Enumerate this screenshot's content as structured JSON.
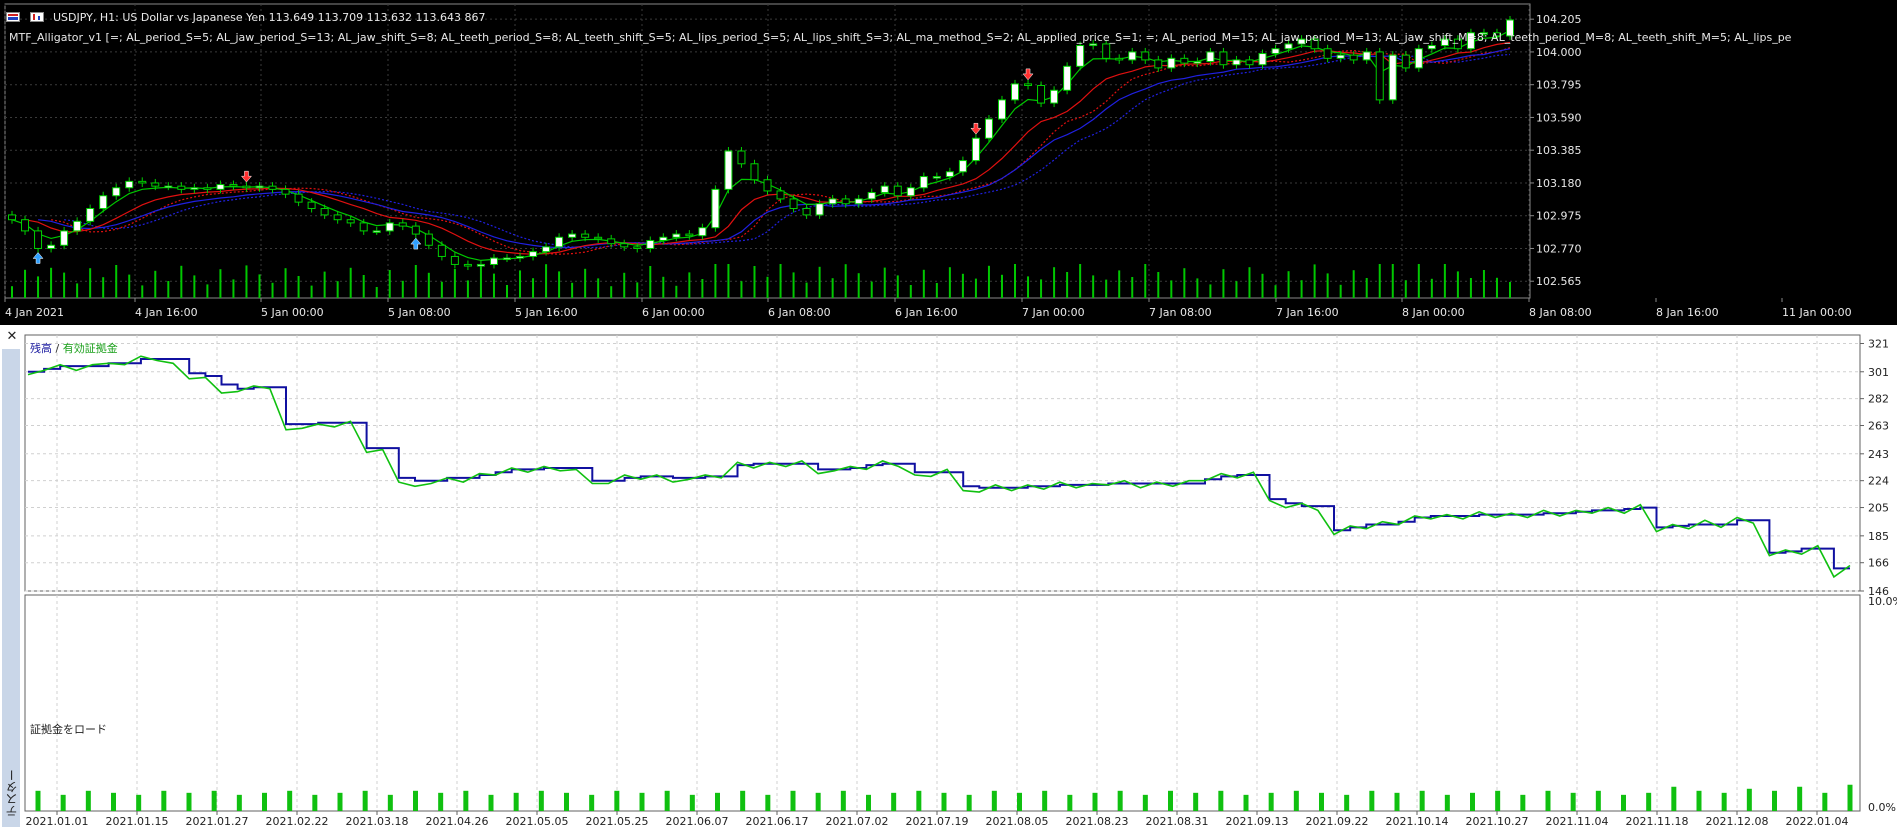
{
  "price_chart": {
    "symbol_text": "USDJPY, H1:  US Dollar vs Japanese Yen  113.649 113.709 113.632 113.643  867",
    "indicator_label": "MTF_Alligator_v1 [=; AL_period_S=5; AL_jaw_period_S=13; AL_jaw_shift_S=8; AL_teeth_period_S=8; AL_teeth_shift_S=5; AL_lips_period_S=5; AL_lips_shift_S=3; AL_ma_method_S=2; AL_applied_price_S=1; =; AL_period_M=15; AL_jaw_period_M=13; AL_jaw_shift_M=8; AL_teeth_period_M=8; AL_teeth_shift_M=5; AL_lips_pe",
    "price_axis": [
      "104.205",
      "104.000",
      "103.795",
      "103.590",
      "103.385",
      "103.180",
      "102.975",
      "102.770",
      "102.565"
    ],
    "time_axis": [
      "4 Jan 2021",
      "4 Jan 16:00",
      "5 Jan 00:00",
      "5 Jan 08:00",
      "5 Jan 16:00",
      "6 Jan 00:00",
      "6 Jan 08:00",
      "6 Jan 16:00",
      "7 Jan 00:00",
      "7 Jan 08:00",
      "7 Jan 16:00",
      "8 Jan 00:00",
      "8 Jan 08:00",
      "8 Jan 16:00",
      "11 Jan 00:00"
    ],
    "colors": {
      "background": "#000000",
      "grid": "#3a3a3a",
      "candle_up": "#ffffff",
      "candle_down": "#000000",
      "lips": "#00c800",
      "teeth": "#e01010",
      "jaw": "#2020e0",
      "volume": "#00c800",
      "sell_arrow": "#ff3030",
      "buy_arrow": "#30a0ff"
    },
    "y_range": [
      102.46,
      104.3
    ]
  },
  "tester": {
    "tab_label": "テスター",
    "legend_balance": "残高",
    "legend_sep": " / ",
    "legend_equity": "有効証拠金",
    "load_label": "証拠金をロード",
    "balance_axis": [
      "321",
      "301",
      "282",
      "263",
      "243",
      "224",
      "205",
      "185",
      "166",
      "146"
    ],
    "load_axis": [
      "10.0%",
      "0.0%"
    ],
    "date_axis": [
      "2021.01.01",
      "2021.01.15",
      "2021.01.27",
      "2021.02.22",
      "2021.03.18",
      "2021.04.26",
      "2021.05.05",
      "2021.05.25",
      "2021.06.07",
      "2021.06.17",
      "2021.07.02",
      "2021.07.19",
      "2021.08.05",
      "2021.08.23",
      "2021.08.31",
      "2021.09.13",
      "2021.09.22",
      "2021.10.14",
      "2021.10.27",
      "2021.11.04",
      "2021.11.18",
      "2021.12.08",
      "2022.01.04"
    ],
    "colors": {
      "balance": "#1010a0",
      "equity": "#10c010",
      "load": "#10c010",
      "grid": "#d0d0d0"
    },
    "y_range": [
      146,
      327
    ]
  },
  "chart_data": [
    {
      "type": "candlestick",
      "title": "USDJPY, H1:  US Dollar vs Japanese Yen  113.649 113.709 113.632 113.643  867",
      "y_axis_ticks": [
        104.205,
        104.0,
        103.795,
        103.59,
        103.385,
        103.18,
        102.975,
        102.77,
        102.565
      ],
      "x_axis_ticks": [
        "4 Jan 2021",
        "4 Jan 16:00",
        "5 Jan 00:00",
        "5 Jan 08:00",
        "5 Jan 16:00",
        "6 Jan 00:00",
        "6 Jan 08:00",
        "6 Jan 16:00",
        "7 Jan 00:00",
        "7 Jan 08:00",
        "7 Jan 16:00",
        "8 Jan 00:00",
        "8 Jan 08:00",
        "8 Jan 16:00",
        "11 Jan 00:00"
      ],
      "close": [
        102.95,
        102.88,
        102.77,
        102.79,
        102.88,
        102.94,
        103.02,
        103.1,
        103.15,
        103.19,
        103.18,
        103.16,
        103.16,
        103.14,
        103.15,
        103.14,
        103.17,
        103.16,
        103.15,
        103.16,
        103.14,
        103.11,
        103.06,
        103.02,
        102.98,
        102.95,
        102.93,
        102.88,
        102.88,
        102.93,
        102.91,
        102.86,
        102.79,
        102.72,
        102.67,
        102.66,
        102.67,
        102.71,
        102.71,
        102.72,
        102.75,
        102.78,
        102.84,
        102.86,
        102.84,
        102.83,
        102.8,
        102.78,
        102.77,
        102.82,
        102.84,
        102.86,
        102.85,
        102.9,
        103.14,
        103.38,
        103.3,
        103.2,
        103.13,
        103.08,
        103.02,
        102.98,
        103.05,
        103.08,
        103.05,
        103.08,
        103.12,
        103.16,
        103.1,
        103.15,
        103.22,
        103.22,
        103.25,
        103.32,
        103.46,
        103.58,
        103.7,
        103.8,
        103.79,
        103.68,
        103.76,
        103.91,
        104.04,
        104.05,
        103.96,
        103.95,
        104.0,
        103.95,
        103.9,
        103.96,
        103.93,
        103.94,
        104.0,
        103.92,
        103.95,
        103.92,
        103.99,
        104.02,
        104.05,
        104.08,
        104.02,
        103.96,
        103.98,
        103.95,
        104.0,
        103.7,
        103.98,
        103.9,
        104.02,
        104.04,
        104.08,
        104.02,
        104.12,
        104.12,
        104.1,
        104.2
      ],
      "series": [
        {
          "name": "lips",
          "color": "#00c800"
        },
        {
          "name": "teeth",
          "color": "#e01010"
        },
        {
          "name": "jaw",
          "color": "#2020e0"
        }
      ]
    },
    {
      "type": "line",
      "legend": [
        "残高",
        "有効証拠金"
      ],
      "y_axis_ticks": [
        321,
        301,
        282,
        263,
        243,
        224,
        205,
        185,
        166,
        146
      ],
      "x_axis_ticks": [
        "2021.01.01",
        "2021.01.15",
        "2021.01.27",
        "2021.02.22",
        "2021.03.18",
        "2021.04.26",
        "2021.05.05",
        "2021.05.25",
        "2021.06.07",
        "2021.06.17",
        "2021.07.02",
        "2021.07.19",
        "2021.08.05",
        "2021.08.23",
        "2021.08.31",
        "2021.09.13",
        "2021.09.22",
        "2021.10.14",
        "2021.10.27",
        "2021.11.04",
        "2021.11.18",
        "2021.12.08",
        "2022.01.04"
      ],
      "ylim": [
        146,
        327
      ],
      "balance": [
        301,
        303,
        305,
        305,
        305,
        307,
        307,
        310,
        310,
        310,
        300,
        298,
        292,
        289,
        290,
        290,
        264,
        264,
        265,
        265,
        265,
        247,
        247,
        226,
        224,
        224,
        226,
        226,
        228,
        230,
        232,
        232,
        233,
        233,
        233,
        224,
        224,
        226,
        227,
        227,
        226,
        226,
        227,
        227,
        235,
        236,
        236,
        236,
        236,
        232,
        232,
        233,
        235,
        236,
        236,
        230,
        230,
        230,
        220,
        219,
        219,
        219,
        220,
        220,
        221,
        221,
        221,
        222,
        222,
        222,
        222,
        222,
        222,
        225,
        227,
        228,
        228,
        211,
        208,
        206,
        206,
        189,
        191,
        193,
        193,
        195,
        198,
        199,
        199,
        199,
        200,
        200,
        200,
        200,
        201,
        201,
        202,
        203,
        203,
        204,
        205,
        191,
        192,
        193,
        193,
        193,
        196,
        196,
        173,
        174,
        176,
        176,
        162,
        162
      ],
      "equity": [
        299,
        302,
        306,
        302,
        306,
        307,
        306,
        312,
        309,
        307,
        296,
        297,
        286,
        287,
        291,
        289,
        260,
        261,
        264,
        262,
        266,
        244,
        246,
        223,
        220,
        222,
        226,
        223,
        229,
        228,
        233,
        230,
        234,
        231,
        232,
        222,
        222,
        228,
        225,
        228,
        223,
        225,
        228,
        226,
        237,
        233,
        237,
        234,
        238,
        229,
        231,
        234,
        232,
        238,
        234,
        228,
        227,
        232,
        217,
        216,
        221,
        217,
        221,
        218,
        223,
        219,
        222,
        221,
        224,
        219,
        223,
        220,
        224,
        224,
        229,
        226,
        230,
        210,
        205,
        208,
        203,
        186,
        192,
        190,
        195,
        193,
        199,
        197,
        200,
        197,
        202,
        198,
        201,
        198,
        203,
        199,
        203,
        201,
        205,
        201,
        207,
        188,
        193,
        190,
        196,
        191,
        198,
        194,
        171,
        175,
        172,
        178,
        156,
        164
      ],
      "load": [
        1.0,
        0.8,
        1.0,
        0.9,
        0.8,
        1.0,
        0.9,
        1.0,
        0.8,
        0.9,
        1.0,
        0.8,
        0.9,
        1.0,
        0.8,
        1.0,
        0.9,
        1.0,
        0.8,
        0.9,
        1.0,
        0.9,
        0.8,
        1.0,
        0.9,
        1.0,
        0.8,
        0.9,
        1.0,
        0.8,
        1.0,
        0.9,
        1.0,
        0.8,
        0.9,
        1.0,
        0.9,
        0.8,
        1.0,
        0.9,
        1.0,
        0.8,
        0.9,
        1.0,
        0.8,
        1.0,
        0.9,
        1.0,
        0.8,
        0.9,
        1.0,
        0.9,
        0.8,
        1.0,
        0.9,
        1.0,
        0.8,
        0.9,
        1.0,
        0.8,
        1.0,
        0.9,
        1.0,
        0.8,
        0.9,
        1.2,
        1.0,
        0.9,
        1.1,
        1.0,
        1.2,
        0.9,
        1.3
      ]
    }
  ]
}
